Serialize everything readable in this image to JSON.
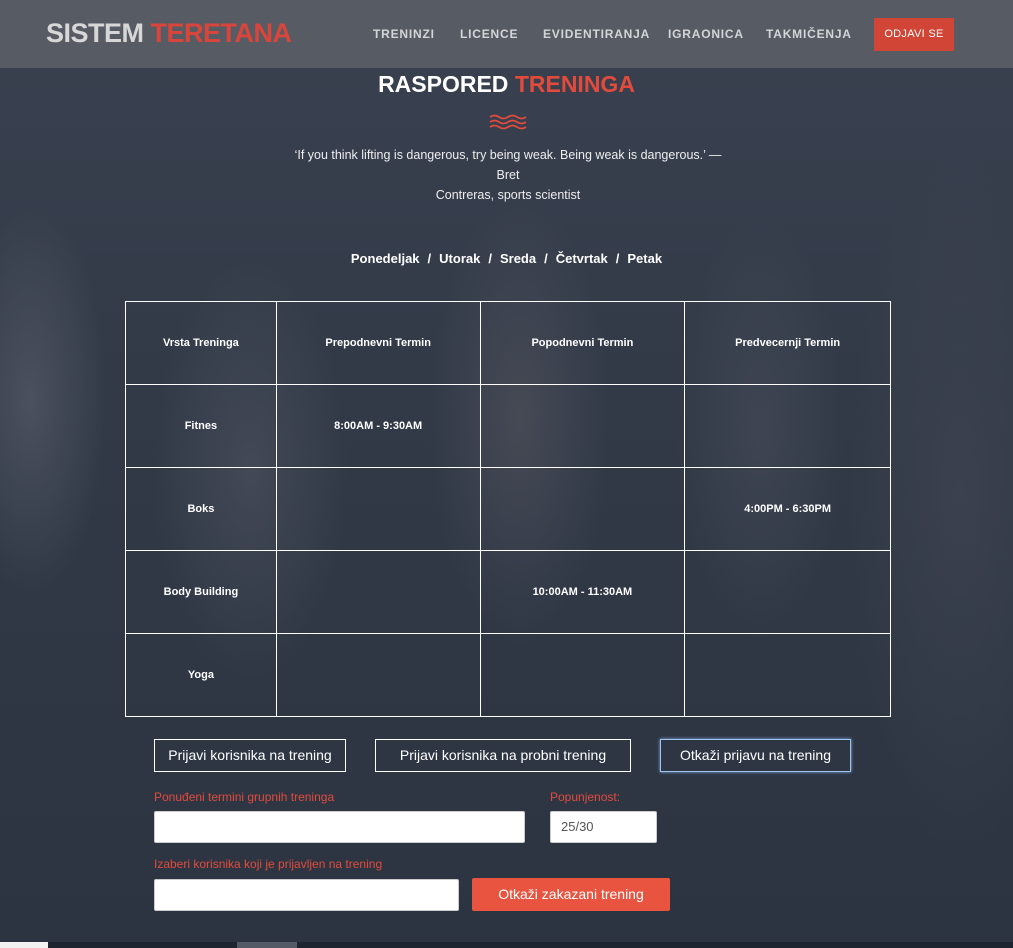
{
  "header": {
    "brand_part1": "SISTEM",
    "brand_part2": "TERETANA",
    "nav": [
      "TRENINZI",
      "LICENCE",
      "EVIDENTIRANJA",
      "IGRAONICA",
      "TAKMIČENJA"
    ],
    "logout_label": "ODJAVI SE"
  },
  "page": {
    "title_part1": "RASPORED",
    "title_part2": "TRENINGA",
    "quote_line1": "‘If you think lifting is dangerous, try being weak. Being weak is dangerous.’ — Bret",
    "quote_line2": "Contreras, sports scientist",
    "days": [
      "Ponedeljak",
      "Utorak",
      "Sreda",
      "Četvrtak",
      "Petak"
    ],
    "day_separator": "/"
  },
  "schedule": {
    "headers": [
      "Vrsta Treninga",
      "Prepodnevni Termin",
      "Popodnevni Termin",
      "Predvecernji Termin"
    ],
    "rows": [
      [
        "Fitnes",
        "8:00AM - 9:30AM",
        "",
        ""
      ],
      [
        "Boks",
        "",
        "",
        "4:00PM - 6:30PM"
      ],
      [
        "Body Building",
        "",
        "10:00AM - 11:30AM",
        ""
      ],
      [
        "Yoga",
        "",
        "",
        ""
      ]
    ]
  },
  "actions": {
    "register_label": "Prijavi korisnika na trening",
    "trial_label": "Prijavi korisnika na probni trening",
    "cancel_registration_label": "Otkaži prijavu na trening"
  },
  "form": {
    "group_terms_label": "Ponuđeni termini grupnih treninga",
    "group_terms_value": "",
    "occupancy_label": "Popunjenost:",
    "occupancy_value": "25/30",
    "select_user_label": "Izaberi korisnika koji je prijavljen na trening",
    "select_user_value": "",
    "cancel_scheduled_label": "Otkaži zakazani trening"
  },
  "colors": {
    "accent": "#e24b3c",
    "topbar": "#575c64",
    "logout": "#d04535",
    "cancel_button": "#e8543f"
  }
}
